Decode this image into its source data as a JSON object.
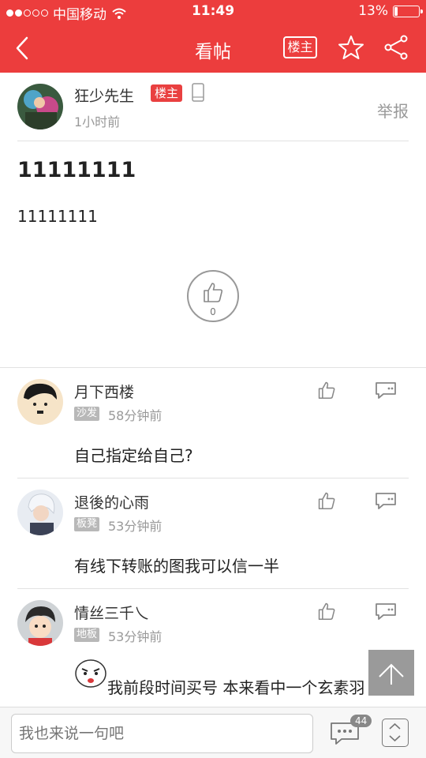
{
  "status_bar": {
    "carrier": "中国移动",
    "time": "11:49",
    "battery_text": "13%",
    "battery_level": 0.13
  },
  "nav": {
    "title": "看帖",
    "owner_only_label": "楼主"
  },
  "post": {
    "author": "狂少先生",
    "owner_badge": "楼主",
    "time": "1小时前",
    "report_label": "举报",
    "title": "11111111",
    "body": "11111111",
    "like_count": "0"
  },
  "comments": [
    {
      "name": "月下西楼",
      "floor": "沙发",
      "time": "58分钟前",
      "text": "自己指定给自己?"
    },
    {
      "name": "退後的心雨",
      "floor": "板凳",
      "time": "53分钟前",
      "text": "有线下转账的图我可以信一半"
    },
    {
      "name": "情丝三千乀",
      "floor": "地板",
      "time": "53分钟前",
      "text": "我前段时间买号  本来看中一个玄素羽"
    }
  ],
  "bottom_bar": {
    "input_placeholder": "我也来说一句吧",
    "message_count": "44"
  },
  "colors": {
    "header_bg": "#ec3d3d",
    "owner_badge": "#e94040",
    "floor_badge": "#b8b8b8"
  }
}
